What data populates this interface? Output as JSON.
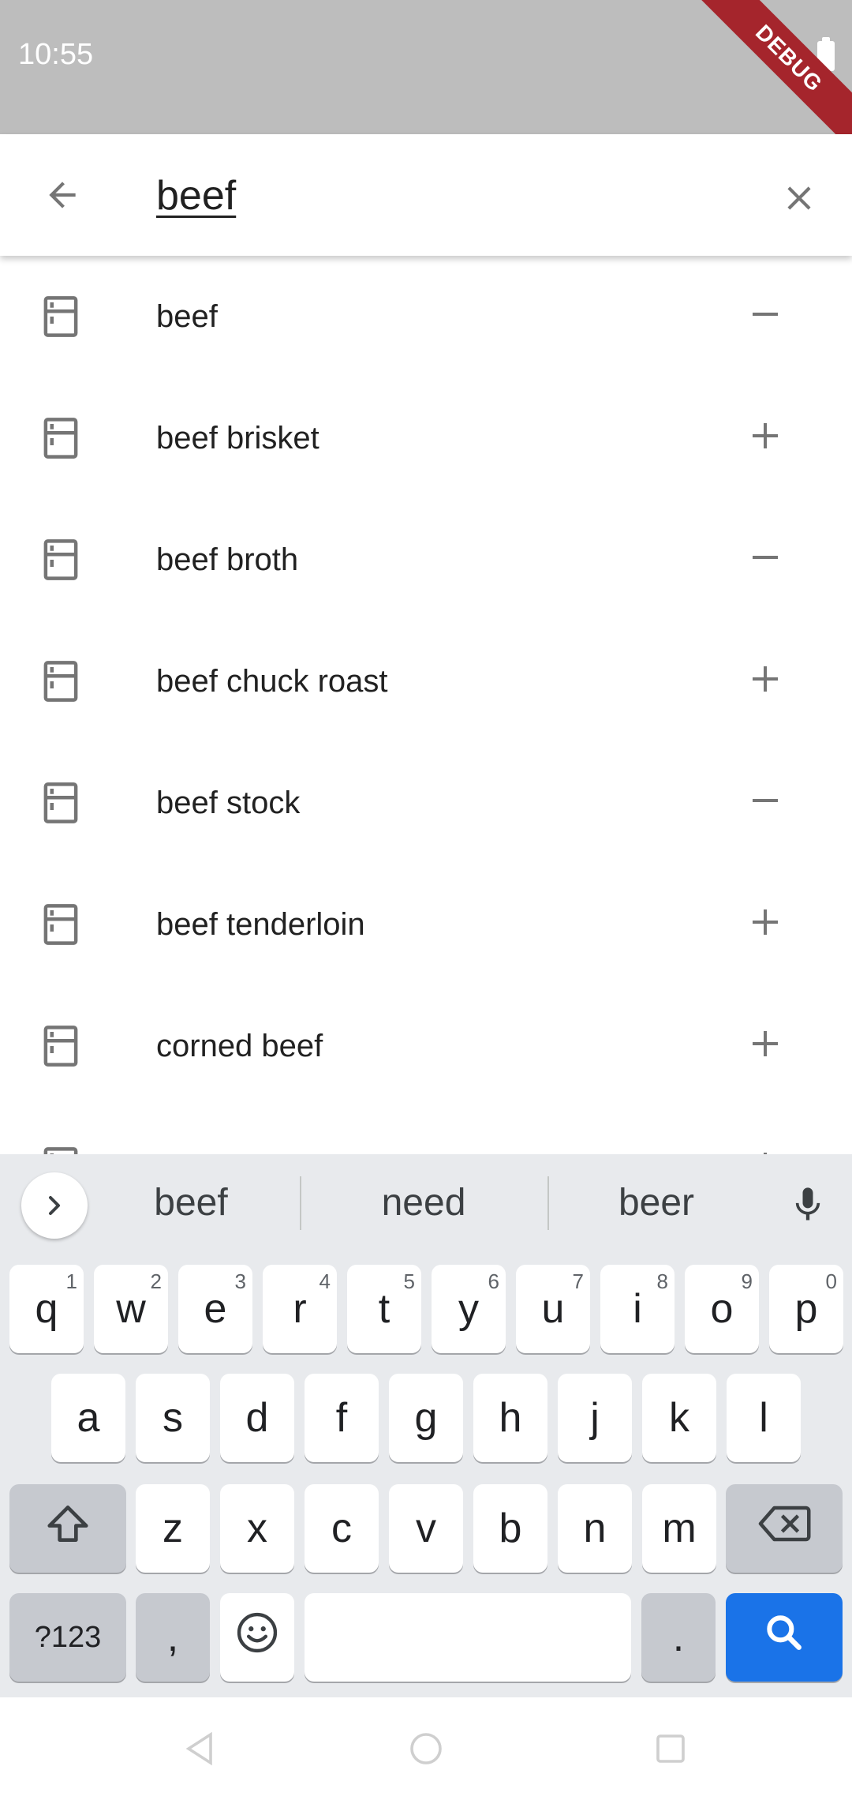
{
  "status_bar": {
    "time": "10:55",
    "debug_label": "DEBUG"
  },
  "search": {
    "query": "beef"
  },
  "results": [
    {
      "label": "beef",
      "action": "remove"
    },
    {
      "label": "beef brisket",
      "action": "add"
    },
    {
      "label": "beef broth",
      "action": "remove"
    },
    {
      "label": "beef chuck roast",
      "action": "add"
    },
    {
      "label": "beef stock",
      "action": "remove"
    },
    {
      "label": "beef tenderloin",
      "action": "add"
    },
    {
      "label": "corned beef",
      "action": "add"
    },
    {
      "label": "",
      "action": "add"
    }
  ],
  "keyboard": {
    "suggestions": [
      "beef",
      "need",
      "beer"
    ],
    "row1": [
      {
        "char": "q",
        "hint": "1"
      },
      {
        "char": "w",
        "hint": "2"
      },
      {
        "char": "e",
        "hint": "3"
      },
      {
        "char": "r",
        "hint": "4"
      },
      {
        "char": "t",
        "hint": "5"
      },
      {
        "char": "y",
        "hint": "6"
      },
      {
        "char": "u",
        "hint": "7"
      },
      {
        "char": "i",
        "hint": "8"
      },
      {
        "char": "o",
        "hint": "9"
      },
      {
        "char": "p",
        "hint": "0"
      }
    ],
    "row2": [
      "a",
      "s",
      "d",
      "f",
      "g",
      "h",
      "j",
      "k",
      "l"
    ],
    "row3": [
      "z",
      "x",
      "c",
      "v",
      "b",
      "n",
      "m"
    ],
    "symbols_label": "?123",
    "comma": ",",
    "period": ".",
    "action_key_icon": "search-icon"
  },
  "colors": {
    "status_bar": "#bdbdbd",
    "debug_banner": "#a5252c",
    "icon_gray": "#757575",
    "keyboard_bg": "#e8eaed",
    "action_blue": "#1a73e8"
  }
}
